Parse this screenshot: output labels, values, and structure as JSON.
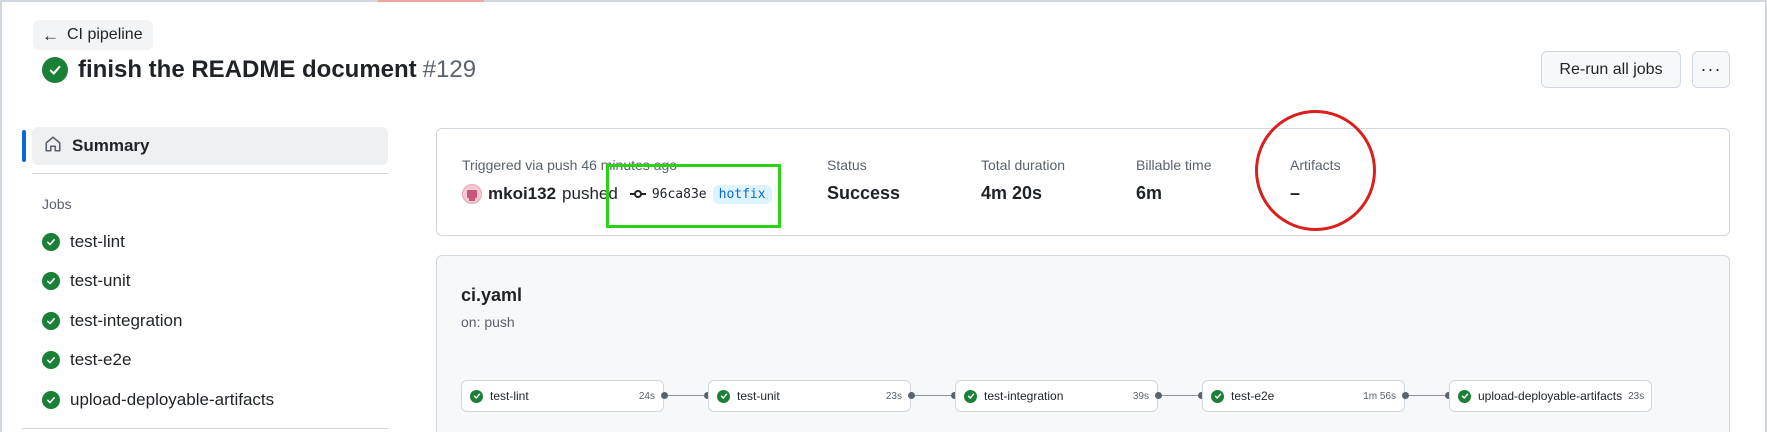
{
  "header": {
    "back_label": "CI pipeline",
    "run_title": "finish the README document",
    "run_number": "#129",
    "rerun_label": "Re-run all jobs",
    "more_label": "···"
  },
  "sidebar": {
    "summary_label": "Summary",
    "jobs_heading": "Jobs",
    "jobs": [
      {
        "label": "test-lint",
        "status": "success"
      },
      {
        "label": "test-unit",
        "status": "success"
      },
      {
        "label": "test-integration",
        "status": "success"
      },
      {
        "label": "test-e2e",
        "status": "success"
      },
      {
        "label": "upload-deployable-artifacts",
        "status": "success"
      }
    ]
  },
  "summary": {
    "trigger_text": "Triggered via push 46 minutes ago",
    "user": "mkoi132",
    "action": "pushed",
    "commit_sha": "96ca83e",
    "branch": "hotfix",
    "status_label": "Status",
    "status_value": "Success",
    "duration_label": "Total duration",
    "duration_value": "4m 20s",
    "billable_label": "Billable time",
    "billable_value": "6m",
    "artifacts_label": "Artifacts",
    "artifacts_value": "–"
  },
  "workflow": {
    "file": "ci.yaml",
    "trigger": "on: push",
    "nodes": [
      {
        "name": "test-lint",
        "duration": "24s"
      },
      {
        "name": "test-unit",
        "duration": "23s"
      },
      {
        "name": "test-integration",
        "duration": "39s"
      },
      {
        "name": "test-e2e",
        "duration": "1m 56s"
      },
      {
        "name": "upload-deployable-artifacts",
        "duration": "23s"
      }
    ]
  },
  "colors": {
    "success": "#1a7f37",
    "accent": "#0969da",
    "highlight_box": "#2bd412",
    "highlight_circle": "#d9201c"
  }
}
